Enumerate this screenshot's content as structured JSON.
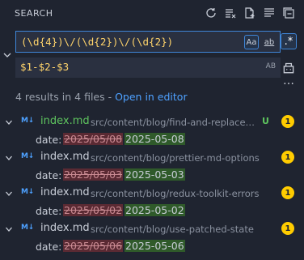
{
  "header": {
    "title": "SEARCH",
    "icons": [
      "refresh-icon",
      "clear-results-icon",
      "new-search-editor-icon",
      "view-as-tree-icon",
      "collapse-all-icon"
    ]
  },
  "search": {
    "value": "(\\d{4})\\/(\\d{2})\\/(\\d{2})",
    "match_case_label": "Aa",
    "whole_word_label": "ab",
    "regex_label": ".*"
  },
  "replace": {
    "value": "$1-$2-$3",
    "preserve_case_label": "AB"
  },
  "summary": {
    "text": "4 results in 4 files - ",
    "link": "Open in editor"
  },
  "results": [
    {
      "file": "index.md",
      "path": "src/content/blog/find-and-replace-...",
      "status": "U",
      "count": "1",
      "match_label": "date:",
      "old": "2025/05/08",
      "new": "2025-05-08",
      "file_color": "#5ec45e"
    },
    {
      "file": "index.md",
      "path": "src/content/blog/prettier-md-options",
      "status": "",
      "count": "1",
      "match_label": "date:",
      "old": "2025/05/03",
      "new": "2025-05-03",
      "file_color": "#c9ced8"
    },
    {
      "file": "index.md",
      "path": "src/content/blog/redux-toolkit-errors",
      "status": "",
      "count": "1",
      "match_label": "date:",
      "old": "2025/05/02",
      "new": "2025-05-02",
      "file_color": "#c9ced8"
    },
    {
      "file": "index.md",
      "path": "src/content/blog/use-patched-state",
      "status": "",
      "count": "1",
      "match_label": "date:",
      "old": "2025/05/06",
      "new": "2025-05-06",
      "file_color": "#c9ced8"
    }
  ],
  "colors": {
    "accent": "#3f86d8",
    "match_text": "#ffd46b",
    "badge": "#ffcc00",
    "removed_bg": "#5a2a33",
    "added_bg": "#2f5a2a"
  }
}
